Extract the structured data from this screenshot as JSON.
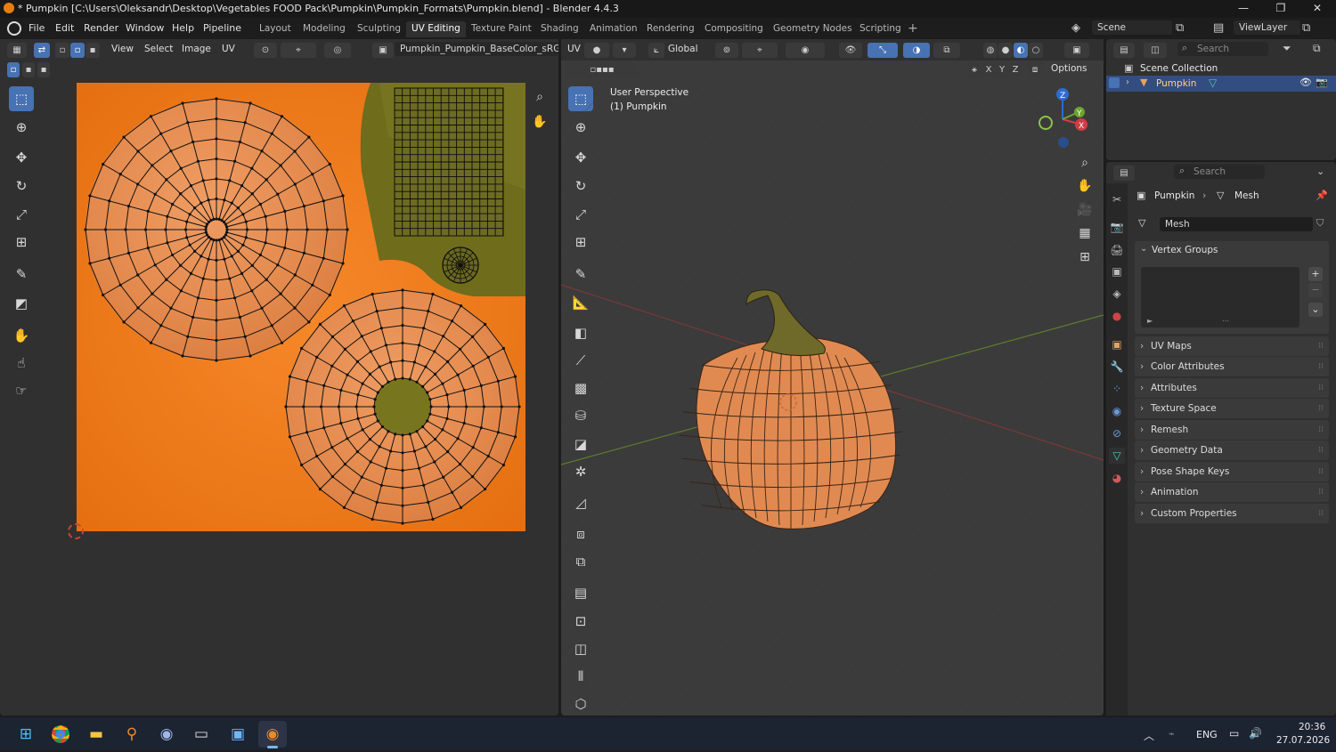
{
  "window": {
    "title": "* Pumpkin [C:\\Users\\Oleksandr\\Desktop\\Vegetables FOOD Pack\\Pumpkin\\Pumpkin_Formats\\Pumpkin.blend] - Blender 4.4.3"
  },
  "menu": [
    "File",
    "Edit",
    "Render",
    "Window",
    "Help",
    "Pipeline"
  ],
  "workspaces": [
    "Layout",
    "Modeling",
    "Sculpting",
    "UV Editing",
    "Texture Paint",
    "Shading",
    "Animation",
    "Rendering",
    "Compositing",
    "Geometry Nodes",
    "Scripting"
  ],
  "active_workspace": "UV Editing",
  "scene": "Scene",
  "view_layer": "ViewLayer",
  "uv_editor": {
    "menus": [
      "View",
      "Select",
      "Image",
      "UV"
    ],
    "image_name": "Pumpkin_Pumpkin_BaseColor_sRGB.p"
  },
  "viewport": {
    "editor_label": "UV",
    "orientation": "Global",
    "options": "Options",
    "axes": [
      "X",
      "Y",
      "Z"
    ],
    "view_name": "User Perspective",
    "object_label": "(1) Pumpkin"
  },
  "outliner": {
    "search_placeholder": "Search",
    "collection": "Scene Collection",
    "object": "Pumpkin"
  },
  "properties": {
    "search_placeholder": "Search",
    "breadcrumb_object": "Pumpkin",
    "breadcrumb_data": "Mesh",
    "mesh_name": "Mesh",
    "vertex_groups": "Vertex Groups",
    "panels": [
      "UV Maps",
      "Color Attributes",
      "Attributes",
      "Texture Space",
      "Remesh",
      "Geometry Data",
      "Pose Shape Keys",
      "Animation",
      "Custom Properties"
    ]
  },
  "taskbar": {
    "lang": "ENG",
    "time": "20:36",
    "date": "27.07.2026"
  },
  "colors": {
    "accent": "#4772b3",
    "pumpkin_orange": "#e8772e",
    "stem_olive": "#6b6a1e",
    "uv_background": "#ee7a18"
  }
}
